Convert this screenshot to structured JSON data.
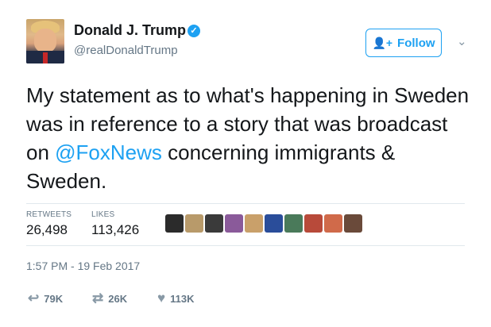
{
  "user": {
    "name": "Donald J. Trump",
    "handle": "@realDonaldTrump",
    "verified_icon": "verified-check-icon",
    "avatar_icon": "profile-photo"
  },
  "follow_button": {
    "label": "Follow",
    "icon": "add-person-icon"
  },
  "menu_caret": {
    "glyph": "⌄",
    "icon": "chevron-down-icon"
  },
  "tweet": {
    "text_part1": "My statement as to what's happening in Sweden was in reference to a story that was broadcast on ",
    "mention": "@FoxNews",
    "text_part2": " concerning immigrants & Sweden."
  },
  "stats": {
    "retweets_label": "RETWEETS",
    "retweets_value": "26,498",
    "likes_label": "LIKES",
    "likes_value": "113,426"
  },
  "likers": {
    "count_shown": 10,
    "colors": [
      "#2b2b2b",
      "#b89a6a",
      "#3a3a3a",
      "#8a5a9a",
      "#c9a06a",
      "#2a4d9a",
      "#4a7a5a",
      "#b84a3a",
      "#d06a4a",
      "#6a4a3a"
    ]
  },
  "timestamp": "1:57 PM - 19 Feb 2017",
  "actions": {
    "reply": {
      "glyph": "↩",
      "count": "79K",
      "icon": "reply-icon"
    },
    "retweet": {
      "glyph": "⇄",
      "count": "26K",
      "icon": "retweet-icon"
    },
    "like": {
      "glyph": "♥",
      "count": "113K",
      "icon": "heart-icon"
    }
  },
  "colors": {
    "accent": "#1da1f2",
    "muted": "#657786",
    "text": "#14171a",
    "divider": "#e1e8ed"
  }
}
